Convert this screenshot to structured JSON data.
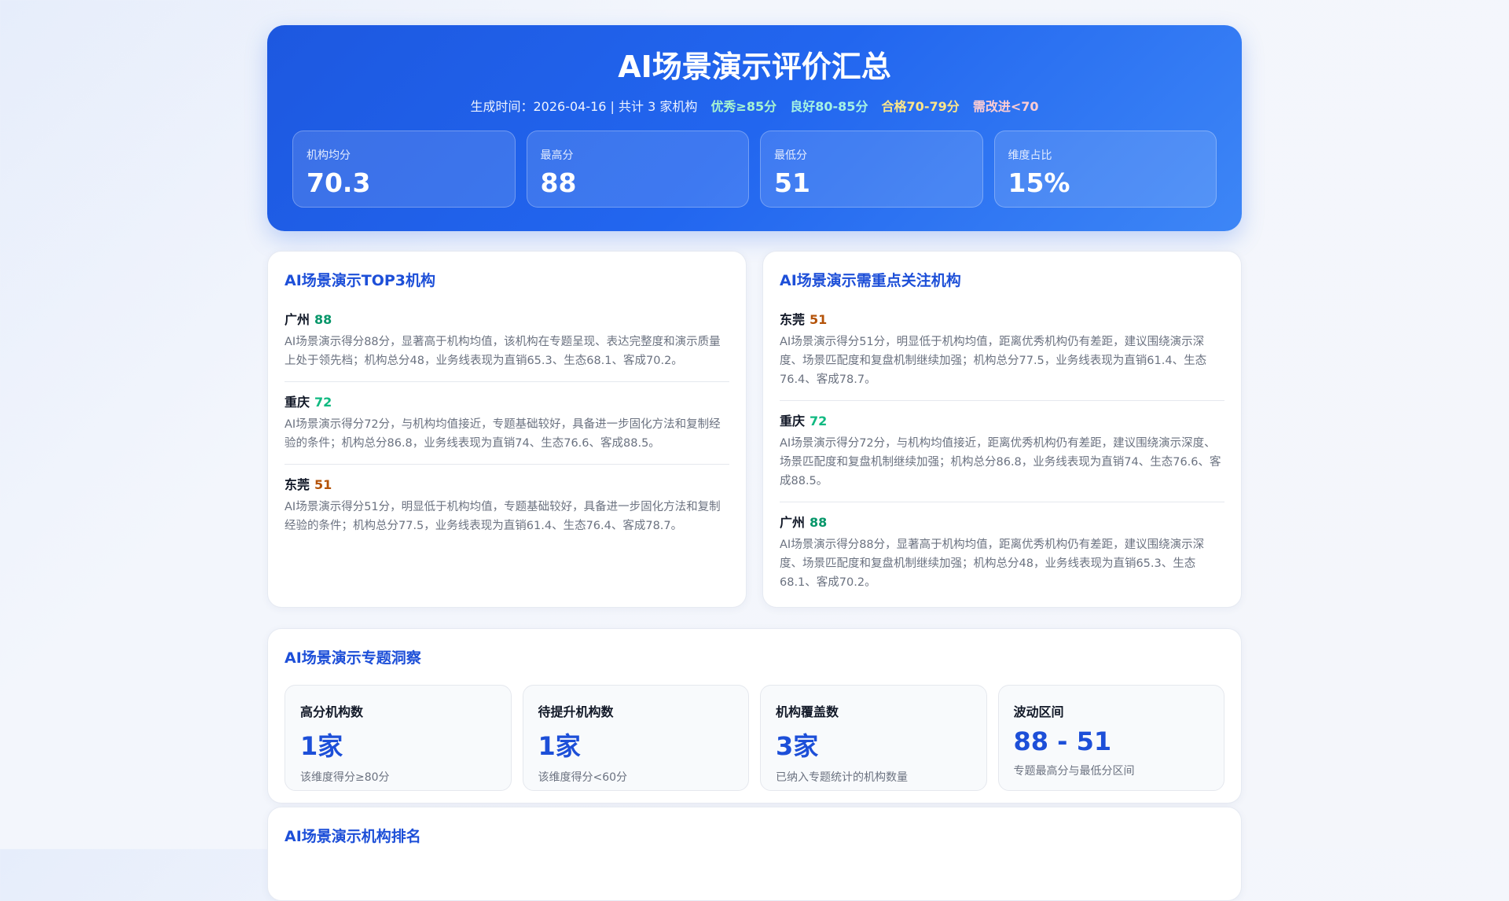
{
  "header": {
    "title": "AI场景演示评价汇总",
    "meta": "生成时间：2026-04-16 | 共计 3 家机构",
    "legend": [
      {
        "label": "优秀≥85分",
        "color": "#a7f3d0"
      },
      {
        "label": "良好80-85分",
        "color": "#a5f3e4"
      },
      {
        "label": "合格70-79分",
        "color": "#fde68a"
      },
      {
        "label": "需改进<70",
        "color": "#fecdd3"
      }
    ],
    "stats": [
      {
        "label": "机构均分",
        "value": "70.3"
      },
      {
        "label": "最高分",
        "value": "88"
      },
      {
        "label": "最低分",
        "value": "51"
      },
      {
        "label": "维度占比",
        "value": "15%"
      }
    ]
  },
  "top3": {
    "title": "AI场景演示TOP3机构",
    "items": [
      {
        "name": "广州",
        "score": "88",
        "color": "#059669",
        "desc": "AI场景演示得分88分，显著高于机构均值，该机构在专题呈现、表达完整度和演示质量上处于领先档；机构总分48，业务线表现为直销65.3、生态68.1、客成70.2。"
      },
      {
        "name": "重庆",
        "score": "72",
        "color": "#10b981",
        "desc": "AI场景演示得分72分，与机构均值接近，专题基础较好，具备进一步固化方法和复制经验的条件；机构总分86.8，业务线表现为直销74、生态76.6、客成88.5。"
      },
      {
        "name": "东莞",
        "score": "51",
        "color": "#b45309",
        "desc": "AI场景演示得分51分，明显低于机构均值，专题基础较好，具备进一步固化方法和复制经验的条件；机构总分77.5，业务线表现为直销61.4、生态76.4、客成78.7。"
      }
    ]
  },
  "focus": {
    "title": "AI场景演示需重点关注机构",
    "items": [
      {
        "name": "东莞",
        "score": "51",
        "color": "#b45309",
        "desc": "AI场景演示得分51分，明显低于机构均值，距离优秀机构仍有差距，建议围绕演示深度、场景匹配度和复盘机制继续加强；机构总分77.5，业务线表现为直销61.4、生态76.4、客成78.7。"
      },
      {
        "name": "重庆",
        "score": "72",
        "color": "#10b981",
        "desc": "AI场景演示得分72分，与机构均值接近，距离优秀机构仍有差距，建议围绕演示深度、场景匹配度和复盘机制继续加强；机构总分86.8，业务线表现为直销74、生态76.6、客成88.5。"
      },
      {
        "name": "广州",
        "score": "88",
        "color": "#059669",
        "desc": "AI场景演示得分88分，显著高于机构均值，距离优秀机构仍有差距，建议围绕演示深度、场景匹配度和复盘机制继续加强；机构总分48，业务线表现为直销65.3、生态68.1、客成70.2。"
      }
    ]
  },
  "insight": {
    "title": "AI场景演示专题洞察",
    "cards": [
      {
        "label": "高分机构数",
        "value": "1家",
        "desc": "该维度得分≥80分"
      },
      {
        "label": "待提升机构数",
        "value": "1家",
        "desc": "该维度得分<60分"
      },
      {
        "label": "机构覆盖数",
        "value": "3家",
        "desc": "已纳入专题统计的机构数量"
      },
      {
        "label": "波动区间",
        "value": "88 - 51",
        "desc": "专题最高分与最低分区间"
      }
    ]
  },
  "ranking": {
    "title": "AI场景演示机构排名"
  }
}
